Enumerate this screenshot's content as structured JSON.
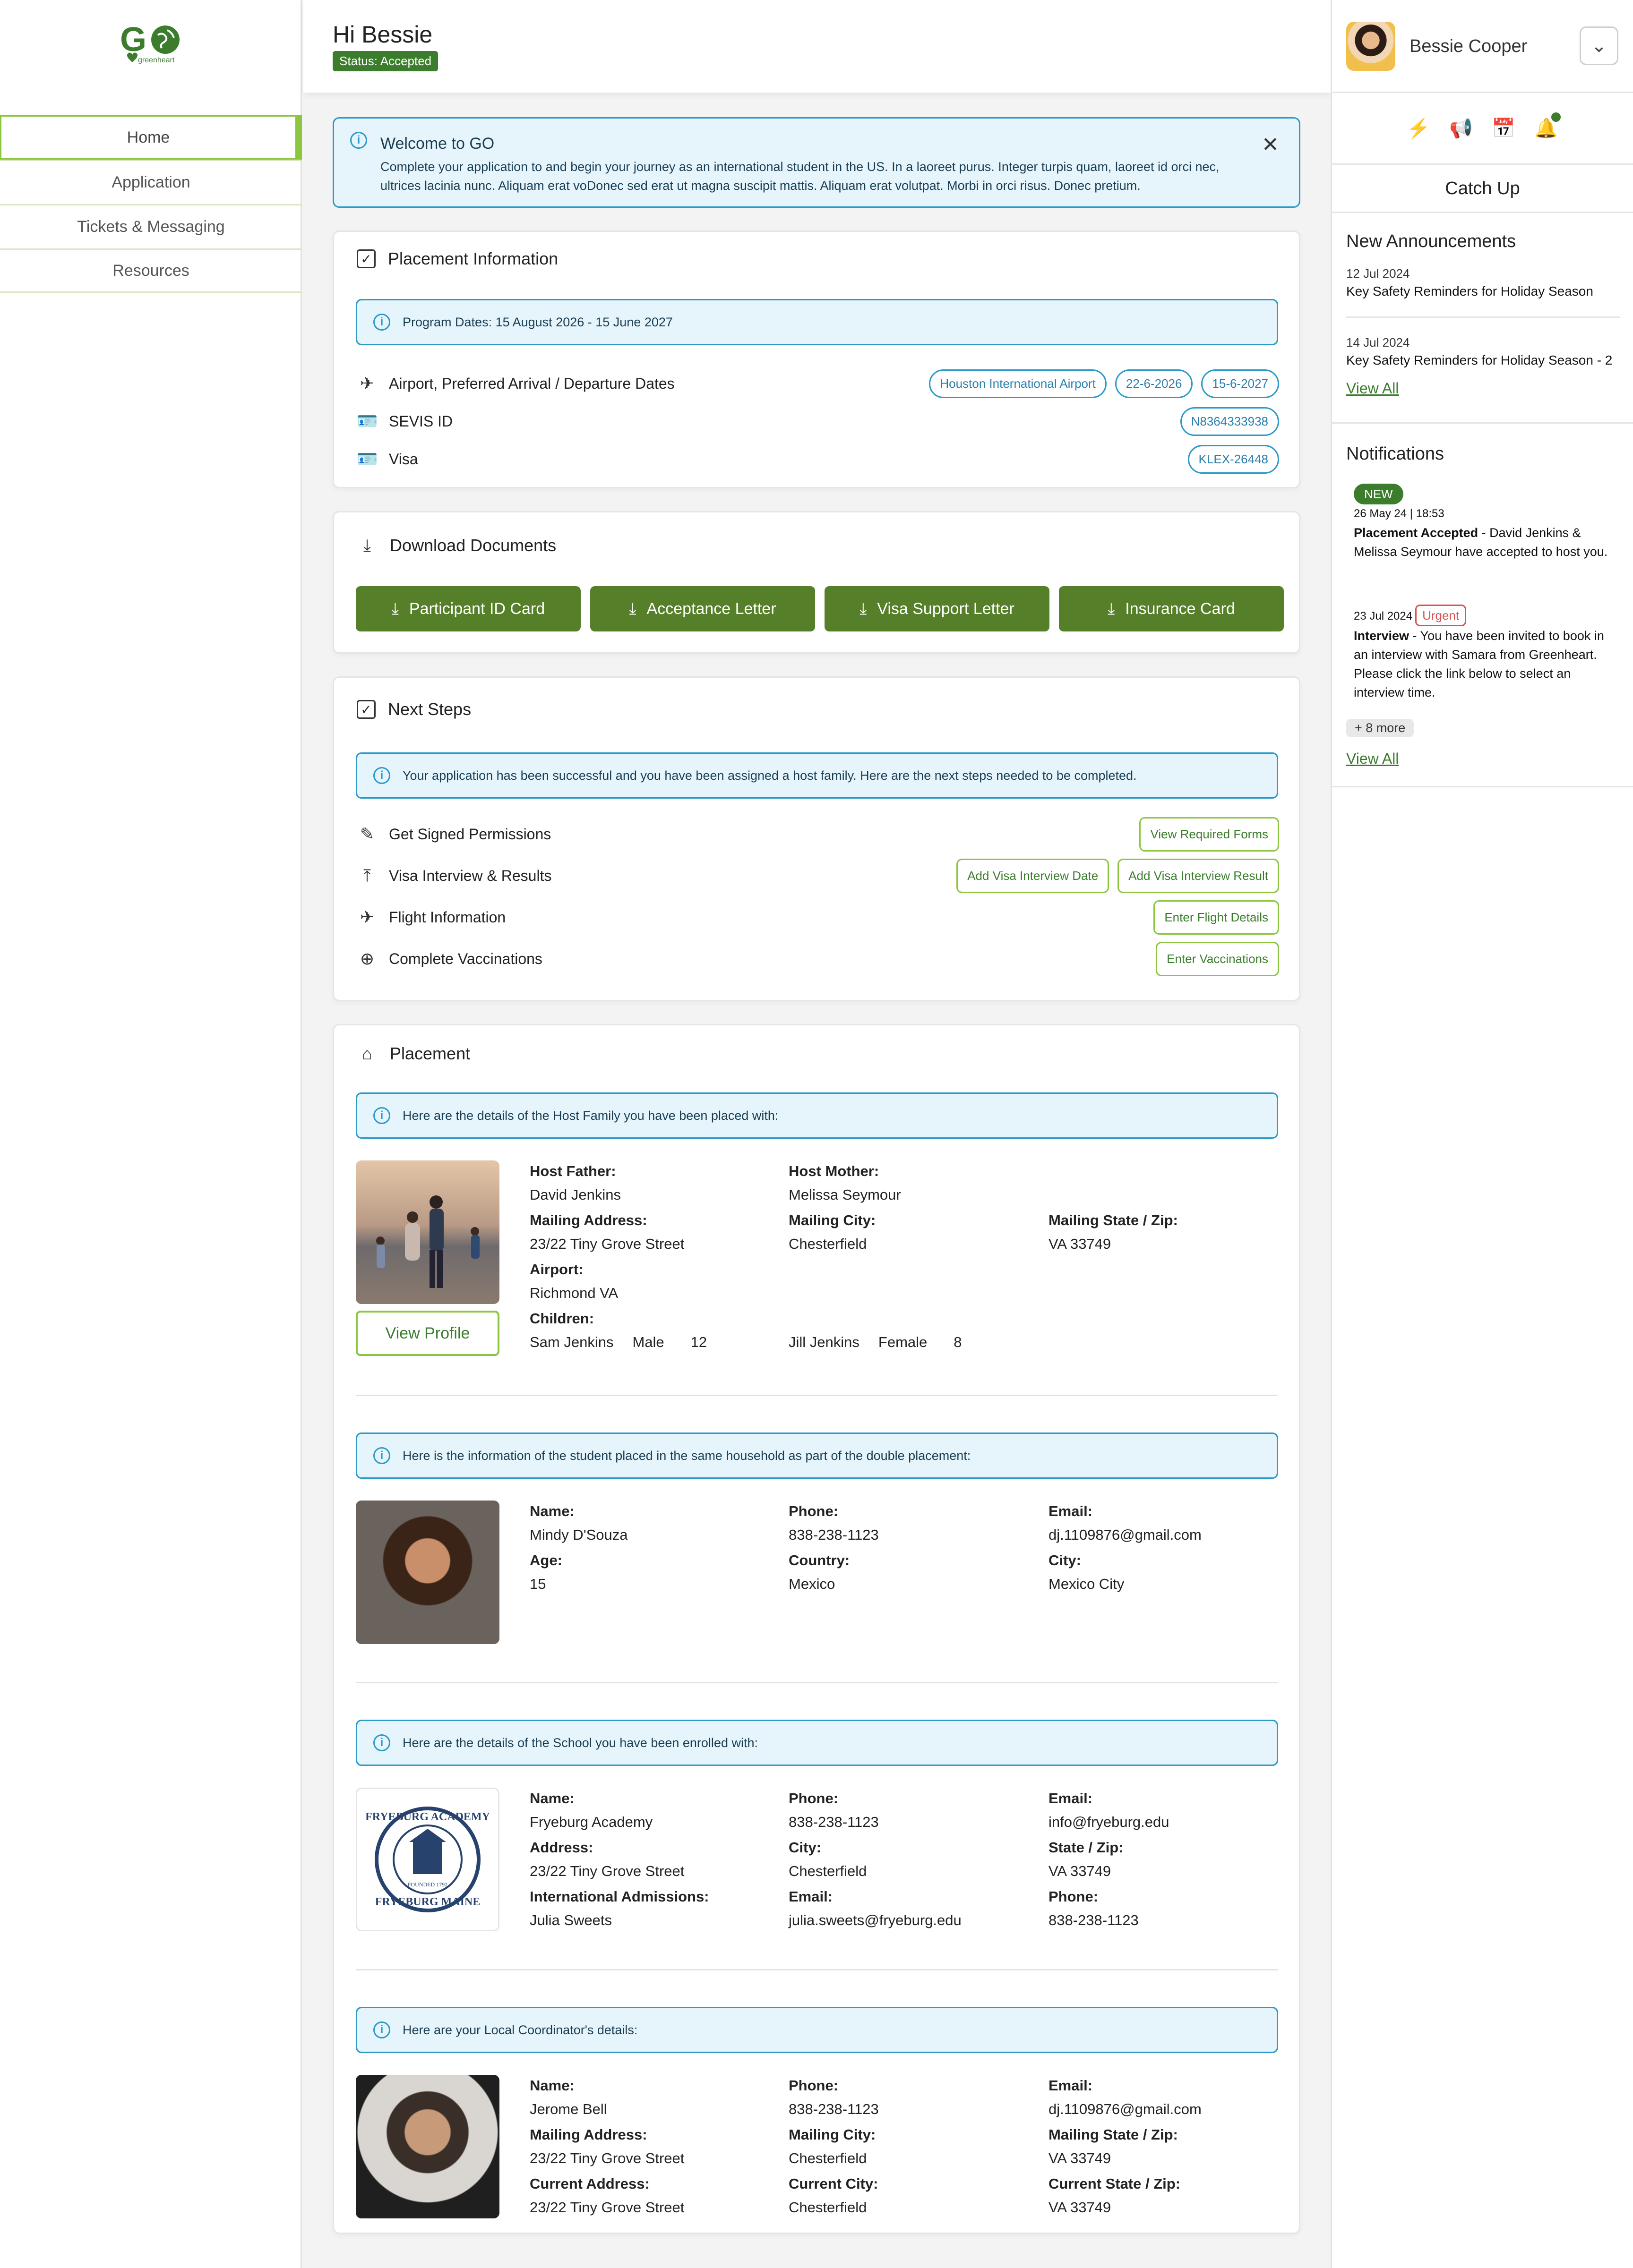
{
  "app": {
    "logo_text": "GO",
    "logo_subtext": "greenheart"
  },
  "nav": {
    "items": [
      "Home",
      "Application",
      "Tickets & Messaging",
      "Resources"
    ],
    "active": "Home"
  },
  "header": {
    "greeting": "Hi Bessie",
    "status": "Status: Accepted"
  },
  "user": {
    "name": "Bessie Cooper"
  },
  "welcome": {
    "title": "Welcome to GO",
    "body": "Complete your application to and begin your journey as an international student in the US. In a laoreet purus. Integer turpis quam, laoreet id orci nec, ultrices lacinia nunc. Aliquam erat voDonec sed erat ut magna suscipit mattis. Aliquam erat volutpat. Morbi in orci risus. Donec pretium."
  },
  "placement_info": {
    "title": "Placement Information",
    "program_dates": "Program Dates: 15 August 2026 - 15 June 2027",
    "airport_label": "Airport, Preferred Arrival / Departure Dates",
    "airport": "Houston International Airport",
    "arrival": "22-6-2026",
    "departure": "15-6-2027",
    "sevis_label": "SEVIS ID",
    "sevis": "N8364333938",
    "visa_label": "Visa",
    "visa": "KLEX-26448"
  },
  "downloads": {
    "title": "Download Documents",
    "buttons": [
      "Participant ID Card",
      "Acceptance Letter",
      "Visa Support Letter",
      "Insurance Card"
    ]
  },
  "next_steps": {
    "title": "Next Steps",
    "info": "Your application has been successful and you have been assigned a host family. Here are the next steps needed to be completed.",
    "items": [
      {
        "label": "Get Signed Permissions",
        "actions": [
          "View Required Forms"
        ]
      },
      {
        "label": "Visa Interview & Results",
        "actions": [
          "Add Visa Interview Date",
          "Add Visa Interview Result"
        ]
      },
      {
        "label": "Flight Information",
        "actions": [
          "Enter Flight Details"
        ]
      },
      {
        "label": "Complete Vaccinations",
        "actions": [
          "Enter Vaccinations"
        ]
      }
    ]
  },
  "placement": {
    "title": "Placement",
    "host_info": "Here are the details of the Host Family you have been placed with:",
    "host": {
      "father_label": "Host Father:",
      "father": "David Jenkins",
      "mother_label": "Host Mother:",
      "mother": "Melissa Seymour",
      "address_label": "Mailing Address:",
      "address": "23/22 Tiny Grove Street",
      "city_label": "Mailing City:",
      "city": "Chesterfield",
      "state_label": "Mailing State / Zip:",
      "state": "VA 33749",
      "airport_label": "Airport:",
      "airport": "Richmond VA",
      "children_label": "Children:",
      "children": [
        {
          "name": "Sam Jenkins",
          "gender": "Male",
          "age": "12"
        },
        {
          "name": "Jill Jenkins",
          "gender": "Female",
          "age": "8"
        }
      ],
      "view_profile": "View Profile"
    },
    "student_info": "Here is the information of the student placed in the same household as part of the double placement:",
    "student": {
      "name_label": "Name:",
      "name": "Mindy D'Souza",
      "phone_label": "Phone:",
      "phone": "838-238-1123",
      "email_label": "Email:",
      "email": "dj.1109876@gmail.com",
      "age_label": "Age:",
      "age": "15",
      "country_label": "Country:",
      "country": "Mexico",
      "city_label": "City:",
      "city": "Mexico City"
    },
    "school_info": "Here are the details of the School you have been enrolled with:",
    "school": {
      "name_label": "Name:",
      "name": "Fryeburg Academy",
      "phone_label": "Phone:",
      "phone": "838-238-1123",
      "email_label": "Email:",
      "email": "info@fryeburg.edu",
      "address_label": "Address:",
      "address": "23/22 Tiny Grove Street",
      "city_label": "City:",
      "city": "Chesterfield",
      "state_label": "State / Zip:",
      "state": "VA 33749",
      "intl_label": "International Admissions:",
      "intl": "Julia Sweets",
      "intl_email_label": "Email:",
      "intl_email": "julia.sweets@fryeburg.edu",
      "intl_phone_label": "Phone:",
      "intl_phone": "838-238-1123",
      "seal_top": "FRYEBURG ACADEMY",
      "seal_bottom": "FRYEBURG MAINE",
      "seal_founded": "FOUNDED 1792"
    },
    "coord_info": "Here are your Local Coordinator's details:",
    "coord": {
      "name_label": "Name:",
      "name": "Jerome Bell",
      "phone_label": "Phone:",
      "phone": "838-238-1123",
      "email_label": "Email:",
      "email": "dj.1109876@gmail.com",
      "maddr_label": "Mailing Address:",
      "maddr": "23/22 Tiny Grove Street",
      "mcity_label": "Mailing City:",
      "mcity": "Chesterfield",
      "mstate_label": "Mailing State / Zip:",
      "mstate": "VA 33749",
      "caddr_label": "Current Address:",
      "caddr": "23/22 Tiny Grove Street",
      "ccity_label": "Current City:",
      "ccity": "Chesterfield",
      "cstate_label": "Current State / Zip:",
      "cstate": "VA 33749"
    }
  },
  "catch_up": {
    "title": "Catch Up",
    "announcements_title": "New Announcements",
    "announcements": [
      {
        "date": "12 Jul 2024",
        "title": "Key Safety Reminders for Holiday Season"
      },
      {
        "date": "14 Jul 2024",
        "title": "Key Safety Reminders for Holiday Season - 2"
      }
    ],
    "view_all": "View All",
    "notifications_title": "Notifications",
    "notifications": [
      {
        "badge": "NEW",
        "date": "26 May 24 | 18:53",
        "bold": "Placement Accepted",
        "text": " - David Jenkins & Melissa Seymour have accepted to host you."
      },
      {
        "badge": "Urgent",
        "date": "23 Jul 2024",
        "bold": "Interview",
        "text": " - You have been invited to book in an interview with Samara from Greenheart. Please click the link below to select an interview time."
      }
    ],
    "more": "+ 8 more",
    "view_all_2": "View All"
  },
  "colors": {
    "brand_green": "#3b7d2c",
    "accent_lime": "#8cc63f",
    "info_blue": "#2b9ac8",
    "button_green": "#557f29"
  },
  "icons": [
    "globe-logo-icon",
    "info-icon",
    "close-icon",
    "checkbox-icon",
    "plane-icon",
    "id-card-icon",
    "download-icon",
    "pen-icon",
    "upload-icon",
    "vaccine-icon",
    "house-icon",
    "flash-list-icon",
    "megaphone-icon",
    "calendar-icon",
    "bell-icon",
    "chevron-down-icon"
  ]
}
